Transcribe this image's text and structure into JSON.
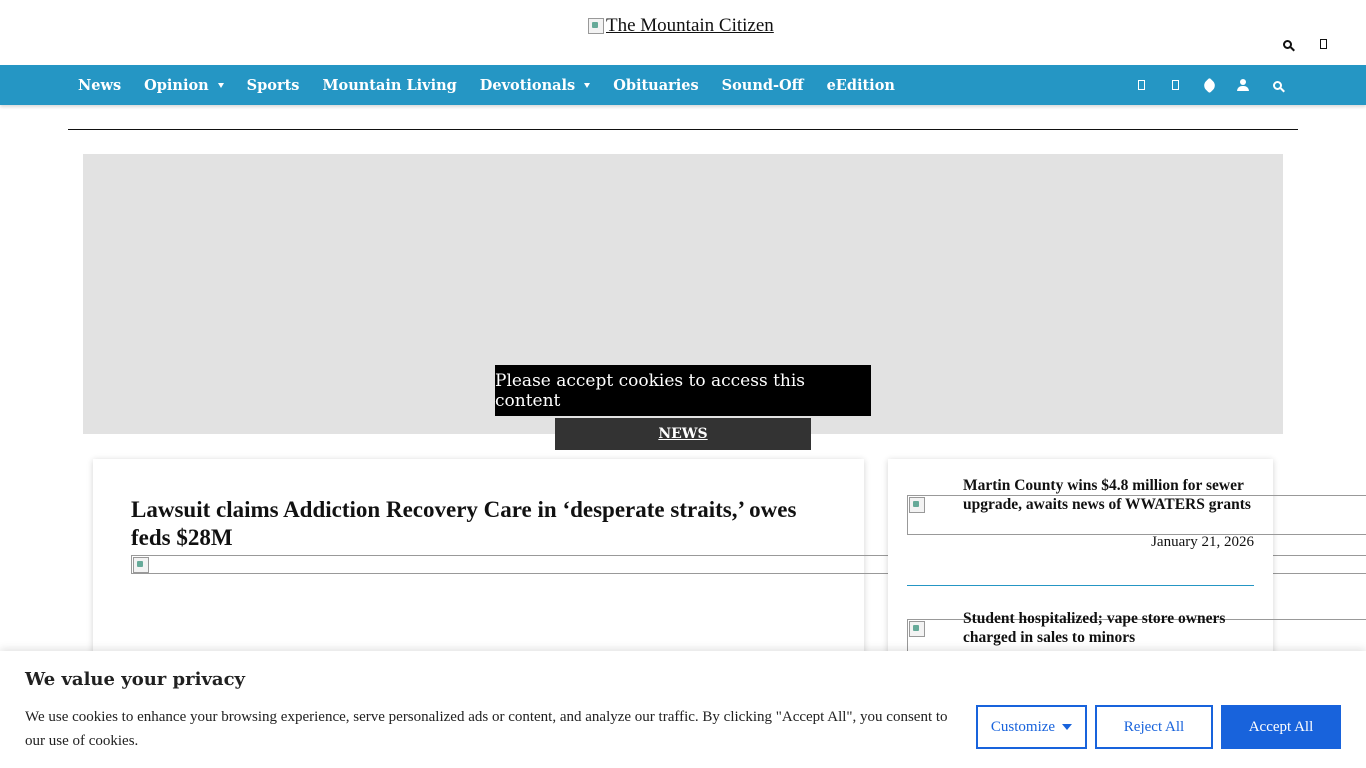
{
  "site": {
    "logo_alt": "The Mountain Citizen"
  },
  "top_icons": [
    "search-icon",
    "menu-icon"
  ],
  "nav": {
    "items": [
      {
        "label": "News",
        "dropdown": false
      },
      {
        "label": "Opinion",
        "dropdown": true
      },
      {
        "label": "Sports",
        "dropdown": false
      },
      {
        "label": "Mountain Living",
        "dropdown": false
      },
      {
        "label": "Devotionals",
        "dropdown": true
      },
      {
        "label": "Obituaries",
        "dropdown": false
      },
      {
        "label": "Sound-Off",
        "dropdown": false
      },
      {
        "label": "eEdition",
        "dropdown": false
      }
    ],
    "icons": [
      "facebook-icon",
      "twitter-icon",
      "tag-icon",
      "user-icon",
      "search-icon"
    ]
  },
  "ad": {
    "cookie_notice": "Please accept cookies to access this content"
  },
  "section_tab": "NEWS",
  "main_article": {
    "headline": "Lawsuit claims Addiction Recovery Care in ‘desperate straits,’ owes feds $28M"
  },
  "sidebar": {
    "articles": [
      {
        "title": "Martin County wins $4.8 million for sewer upgrade, awaits news of WWATERS grants",
        "date": "January 21, 2026"
      },
      {
        "title": "Student hospitalized; vape store owners charged in sales to minors",
        "date": ""
      }
    ]
  },
  "consent": {
    "title": "We value your privacy",
    "text": "We use cookies to enhance your browsing experience, serve personalized ads or content, and analyze our traffic. By clicking \"Accept All\", you consent to our use of cookies.",
    "customize_label": "Customize",
    "reject_label": "Reject All",
    "accept_label": "Accept All"
  },
  "colors": {
    "nav_bg": "#2596c4",
    "primary_button": "#1863dc",
    "ad_bg": "#e2e2e2",
    "section_tab_bg": "#333333"
  }
}
